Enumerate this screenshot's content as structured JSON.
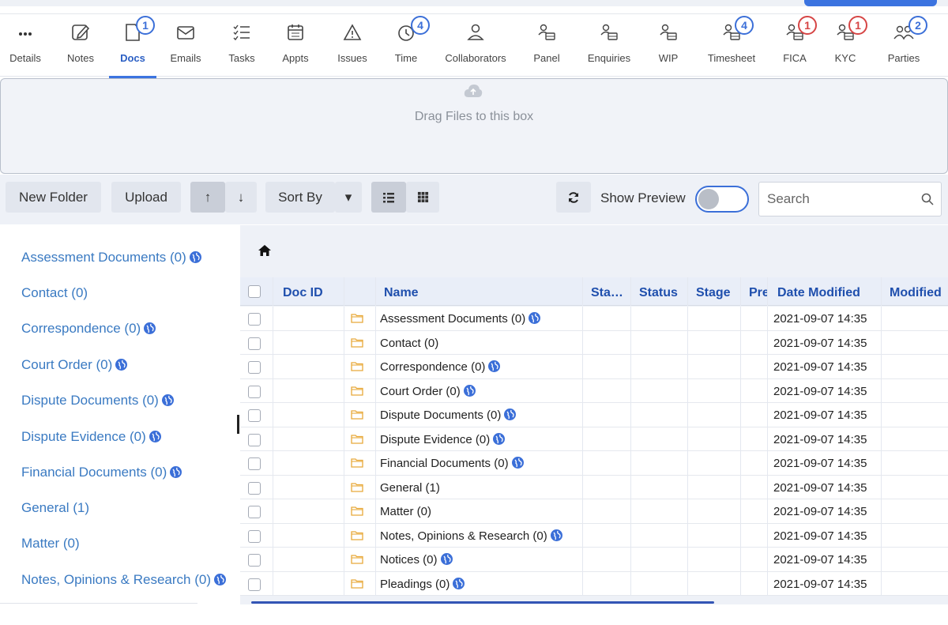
{
  "tabs": [
    {
      "label": "Details",
      "icon": "more-dots-icon"
    },
    {
      "label": "Notes",
      "icon": "edit-note-icon"
    },
    {
      "label": "Docs",
      "icon": "document-icon",
      "badge": "1",
      "active": true
    },
    {
      "label": "Emails",
      "icon": "mail-icon"
    },
    {
      "label": "Tasks",
      "icon": "checklist-icon"
    },
    {
      "label": "Appts",
      "icon": "calendar-icon"
    },
    {
      "label": "Issues",
      "icon": "warning-icon"
    },
    {
      "label": "Time",
      "icon": "clock-icon",
      "badge": "4"
    },
    {
      "label": "Collaborators",
      "icon": "user-icon"
    },
    {
      "label": "Panel",
      "icon": "user-group-icon"
    },
    {
      "label": "Enquiries",
      "icon": "user-group-icon"
    },
    {
      "label": "WIP",
      "icon": "user-group-icon"
    },
    {
      "label": "Timesheet",
      "icon": "user-group-icon",
      "badge": "4"
    },
    {
      "label": "FICA",
      "icon": "user-group-icon",
      "badge": "1",
      "badge_color": "red"
    },
    {
      "label": "KYC",
      "icon": "user-group-icon",
      "badge": "1",
      "badge_color": "red"
    },
    {
      "label": "Parties",
      "icon": "people-icon",
      "badge": "2"
    }
  ],
  "dropzone": {
    "text": "Drag Files to this box"
  },
  "toolbar": {
    "new_folder": "New Folder",
    "upload": "Upload",
    "sort_asc": "↑",
    "sort_desc": "↓",
    "sort_by": "Sort By",
    "sort_caret": "▾",
    "show_preview": "Show Preview",
    "search_placeholder": "Search"
  },
  "tree": {
    "items": [
      {
        "label": "Assessment Documents (0)",
        "shared": true
      },
      {
        "label": "Contact (0)",
        "shared": false
      },
      {
        "label": "Correspondence (0)",
        "shared": true
      },
      {
        "label": "Court Order (0)",
        "shared": true
      },
      {
        "label": "Dispute Documents (0)",
        "shared": true
      },
      {
        "label": "Dispute Evidence (0)",
        "shared": true
      },
      {
        "label": "Financial Documents (0)",
        "shared": true
      },
      {
        "label": "General (1)",
        "shared": false
      },
      {
        "label": "Matter (0)",
        "shared": false
      },
      {
        "label": "Notes, Opinions & Research (0)",
        "shared": true
      }
    ]
  },
  "grid": {
    "headers": {
      "doc_id": "Doc ID",
      "name": "Name",
      "sta": "Sta…",
      "status": "Status",
      "stage": "Stage",
      "pre": "Pre",
      "date_modified": "Date Modified",
      "modified": "Modified"
    },
    "rows": [
      {
        "name": "Assessment Documents (0)",
        "shared": true,
        "date": "2021-09-07 14:35"
      },
      {
        "name": "Contact (0)",
        "shared": false,
        "date": "2021-09-07 14:35"
      },
      {
        "name": "Correspondence (0)",
        "shared": true,
        "date": "2021-09-07 14:35"
      },
      {
        "name": "Court Order (0)",
        "shared": true,
        "date": "2021-09-07 14:35"
      },
      {
        "name": "Dispute Documents (0)",
        "shared": true,
        "date": "2021-09-07 14:35"
      },
      {
        "name": "Dispute Evidence (0)",
        "shared": true,
        "date": "2021-09-07 14:35"
      },
      {
        "name": "Financial Documents (0)",
        "shared": true,
        "date": "2021-09-07 14:35"
      },
      {
        "name": "General (1)",
        "shared": false,
        "date": "2021-09-07 14:35"
      },
      {
        "name": "Matter (0)",
        "shared": false,
        "date": "2021-09-07 14:35"
      },
      {
        "name": "Notes, Opinions & Research (0)",
        "shared": true,
        "date": "2021-09-07 14:35"
      },
      {
        "name": "Notices (0)",
        "shared": true,
        "date": "2021-09-07 14:35"
      },
      {
        "name": "Pleadings (0)",
        "shared": true,
        "date": "2021-09-07 14:35"
      }
    ]
  },
  "colors": {
    "accent": "#3b73e0",
    "link": "#3a7ac2",
    "header_text": "#1f4fad",
    "badge_red": "#d64545",
    "folder": "#e8a93a"
  }
}
